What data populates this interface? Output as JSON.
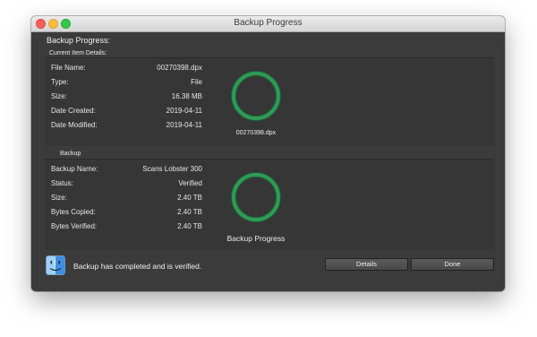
{
  "window": {
    "title": "Backup Progress"
  },
  "heading": "Backup Progress:",
  "current_item": {
    "section_label": "Current Item Details:",
    "rows": [
      {
        "label": "File Name:",
        "value": "00270398.dpx"
      },
      {
        "label": "Type:",
        "value": "File"
      },
      {
        "label": "Size:",
        "value": "16.38 MB"
      },
      {
        "label": "Date Created:",
        "value": "2019-04-11"
      },
      {
        "label": "Date Modified:",
        "value": "2019-04-11"
      }
    ],
    "ring_caption": "00270398.dpx",
    "progress": 1.0
  },
  "backup": {
    "section_label": "Backup",
    "rows": [
      {
        "label": "Backup Name:",
        "value": "Scans Lobster 300"
      },
      {
        "label": "Status:",
        "value": "Verified"
      },
      {
        "label": "Size:",
        "value": "2.40 TB"
      },
      {
        "label": "Bytes Copied:",
        "value": "2.40 TB"
      },
      {
        "label": "Bytes Verified:",
        "value": "2.40 TB"
      }
    ],
    "ring_caption": "Backup Progress",
    "progress": 1.0
  },
  "footer": {
    "status": "Backup has completed and is verified.",
    "details_label": "Details",
    "done_label": "Done",
    "icon": "finder-icon"
  },
  "colors": {
    "ring_green": "#2e9a56",
    "ring_track": "#1f5c38"
  }
}
